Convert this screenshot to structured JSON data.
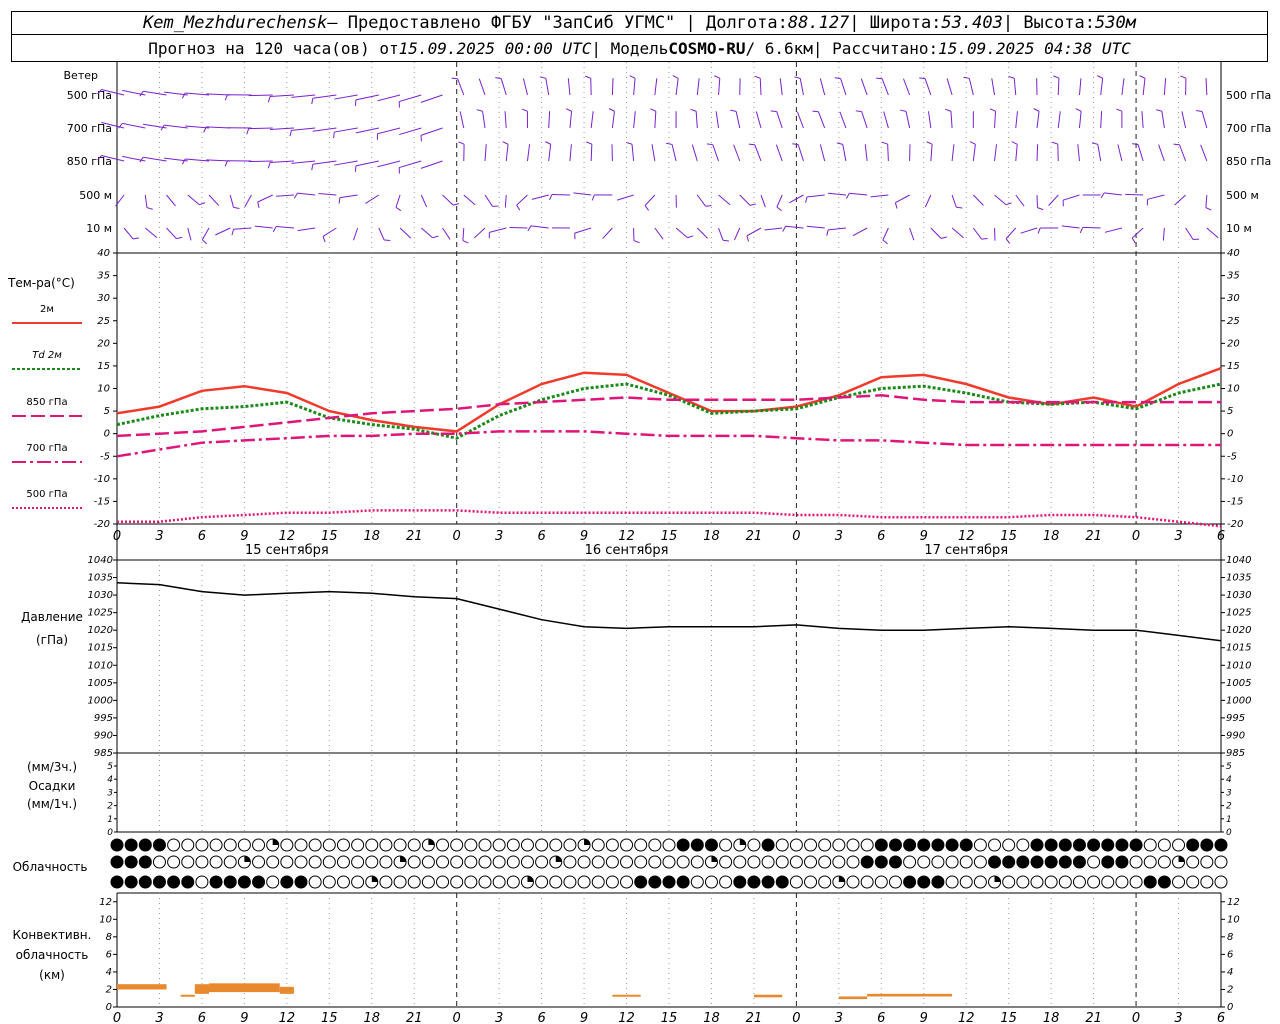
{
  "header": {
    "station": "Kem_Mezhdurechensk",
    "provided_prefix": " — Предоставлено ФГБУ \"ЗапСиб УГМС\" | Долгота: ",
    "lon": "88.127",
    "lat_label": " | Широта: ",
    "lat": "53.403",
    "alt_label": " | Высота: ",
    "alt": "530м",
    "forecast_prefix": "Прогноз на 120 часа(ов) от ",
    "forecast_from": "15.09.2025 00:00 UTC",
    "model_prefix": "  | Модель ",
    "model": "COSMO-RU",
    "model_res": " / 6.6км",
    "calc_prefix": " | Рассчитано: ",
    "calc_time": "15.09.2025 04:38 UTC"
  },
  "x_ticks": [
    "0",
    "3",
    "6",
    "9",
    "12",
    "15",
    "18",
    "21",
    "0",
    "3",
    "6",
    "9",
    "12",
    "15",
    "18",
    "21",
    "0",
    "3",
    "6",
    "9",
    "12",
    "15",
    "18",
    "21",
    "0",
    "3",
    "6"
  ],
  "day_labels": [
    "15 сентября",
    "16 сентября",
    "17 сентября"
  ],
  "wind_panel": {
    "title": "Ветер",
    "levels": [
      "500 гПа",
      "700 гПа",
      "850 гПа",
      "500 м",
      "10  м"
    ],
    "color": "#7a1fd0"
  },
  "temp_panel": {
    "title": "Тем-ра(°С)",
    "legend": [
      {
        "label": "2м",
        "color": "#f03a2c",
        "style": "solid"
      },
      {
        "label": "Td  2м",
        "color": "#1a8a1a",
        "style": "dotted"
      },
      {
        "label": "850 гПа",
        "color": "#e0157a",
        "style": "longdash"
      },
      {
        "label": "700 гПа",
        "color": "#e0157a",
        "style": "dashdot"
      },
      {
        "label": "500 гПа",
        "color": "#e0157a",
        "style": "fine-dotted"
      }
    ],
    "y_ticks": [
      "40",
      "35",
      "30",
      "25",
      "20",
      "15",
      "10",
      "5",
      "0",
      "-5",
      "-10",
      "-15",
      "-20"
    ]
  },
  "pressure_panel": {
    "title": "Давление",
    "unit": "(гПа)",
    "y_ticks": [
      "1040",
      "1035",
      "1030",
      "1025",
      "1020",
      "1015",
      "1010",
      "1005",
      "1000",
      "995",
      "990",
      "985"
    ]
  },
  "precip_panel": {
    "unit3": "(мм/3ч.)",
    "title": "Осадки",
    "unit1": "(мм/1ч.)",
    "y_ticks": [
      "5",
      "4",
      "3",
      "2",
      "1",
      "0"
    ]
  },
  "cloud_panel": {
    "title": "Облачность"
  },
  "conv_panel": {
    "title1": "Конвективн.",
    "title2": "облачность",
    "unit": "(км)",
    "y_ticks": [
      "12",
      "10",
      "8",
      "6",
      "4",
      "2",
      "0"
    ],
    "color": "#e8892e"
  },
  "chart_data": [
    {
      "type": "line",
      "title": "Тем-ра(°С)",
      "x_hours": [
        0,
        3,
        6,
        9,
        12,
        15,
        18,
        21,
        24,
        27,
        30,
        33,
        36,
        39,
        42,
        45,
        48,
        51,
        54,
        57,
        60,
        63,
        66,
        69,
        72,
        75,
        78
      ],
      "ylim": [
        -20,
        40
      ],
      "series": [
        {
          "name": "2м",
          "values": [
            4.5,
            6,
            9.5,
            10.5,
            9,
            5,
            3,
            1.5,
            0.5,
            6.5,
            11,
            13.5,
            13,
            9,
            5,
            5,
            6,
            8.5,
            12.5,
            13,
            11,
            8,
            6.5,
            8,
            6,
            11,
            14.5
          ]
        },
        {
          "name": "Td  2м",
          "values": [
            2,
            4,
            5.5,
            6,
            7,
            3.5,
            2,
            1,
            -1,
            4,
            7.5,
            10,
            11,
            8.5,
            4.5,
            5,
            5.5,
            8,
            10,
            10.5,
            9,
            7,
            6.5,
            7,
            5.5,
            9,
            11
          ]
        },
        {
          "name": "850 гПа",
          "values": [
            -0.5,
            0,
            0.5,
            1.5,
            2.5,
            3.5,
            4.5,
            5,
            5.5,
            6.5,
            7,
            7.5,
            8,
            7.5,
            7.5,
            7.5,
            7.5,
            8,
            8.5,
            7.5,
            7,
            7,
            7,
            7,
            7,
            7,
            7
          ]
        },
        {
          "name": "700 гПа",
          "values": [
            -5,
            -3.5,
            -2,
            -1.5,
            -1,
            -0.5,
            -0.5,
            0,
            0,
            0.5,
            0.5,
            0.5,
            0,
            -0.5,
            -0.5,
            -0.5,
            -1,
            -1.5,
            -1.5,
            -2,
            -2.5,
            -2.5,
            -2.5,
            -2.5,
            -2.5,
            -2.5,
            -2.5
          ]
        },
        {
          "name": "500 гПа",
          "values": [
            -19.5,
            -19.5,
            -18.5,
            -18,
            -17.5,
            -17.5,
            -17,
            -17,
            -17,
            -17.5,
            -17.5,
            -17.5,
            -17.5,
            -17.5,
            -17.5,
            -17.5,
            -18,
            -18,
            -18.5,
            -18.5,
            -18.5,
            -18.5,
            -18,
            -18,
            -18.5,
            -19.5,
            -20.5
          ]
        }
      ]
    },
    {
      "type": "line",
      "title": "Давление",
      "x_hours": [
        0,
        3,
        6,
        9,
        12,
        15,
        18,
        21,
        24,
        27,
        30,
        33,
        36,
        39,
        42,
        45,
        48,
        51,
        54,
        57,
        60,
        63,
        66,
        69,
        72,
        75,
        78
      ],
      "ylim": [
        985,
        1040
      ],
      "series": [
        {
          "name": "",
          "values": [
            1033.5,
            1033,
            1031,
            1030,
            1030.5,
            1031,
            1030.5,
            1029.5,
            1029,
            1026,
            1023,
            1021,
            1020.5,
            1021,
            1021,
            1021,
            1021.5,
            1020.5,
            1020,
            1020,
            1020.5,
            1021,
            1020.5,
            1020,
            1020,
            1018.5,
            1017
          ]
        }
      ]
    },
    {
      "type": "bar",
      "title": "Конвективн. облачность",
      "ylim": [
        0,
        13
      ],
      "segments": [
        {
          "from_h": 0,
          "to_h": 3.5,
          "base": 2,
          "top": 2.6
        },
        {
          "from_h": 4.5,
          "to_h": 5.5,
          "base": 1.2,
          "top": 1.4
        },
        {
          "from_h": 5.5,
          "to_h": 6.5,
          "base": 1.5,
          "top": 2.6
        },
        {
          "from_h": 6.5,
          "to_h": 11.5,
          "base": 1.7,
          "top": 2.7
        },
        {
          "from_h": 11.5,
          "to_h": 12.5,
          "base": 1.5,
          "top": 2.3
        },
        {
          "from_h": 35,
          "to_h": 37,
          "base": 1.2,
          "top": 1.4
        },
        {
          "from_h": 45,
          "to_h": 47,
          "base": 1.1,
          "top": 1.4
        },
        {
          "from_h": 51,
          "to_h": 53,
          "base": 0.9,
          "top": 1.2
        },
        {
          "from_h": 53,
          "to_h": 59,
          "base": 1.2,
          "top": 1.5
        }
      ]
    }
  ]
}
